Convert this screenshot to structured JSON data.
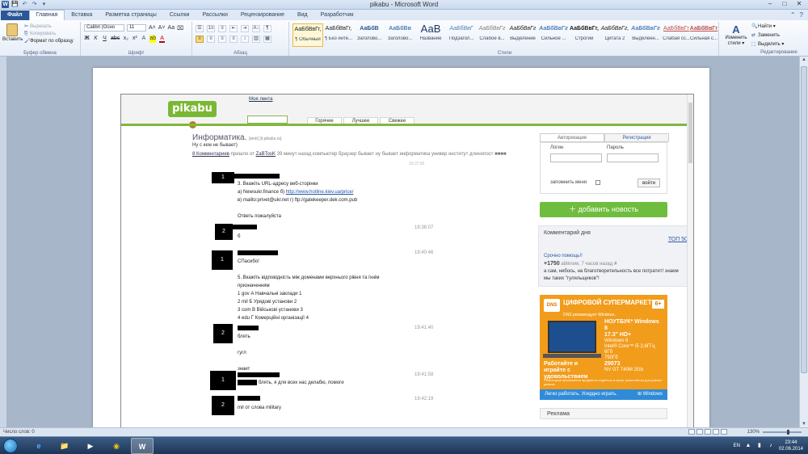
{
  "window": {
    "title": "pikabu - Microsoft Word",
    "controls": {
      "minimize": "–",
      "maximize": "□",
      "close": "✕"
    }
  },
  "qat": {
    "logo": "W",
    "save": "💾",
    "undo": "↶",
    "redo": "↷",
    "more": "▾"
  },
  "ribbon_tabs": [
    {
      "label": "Файл"
    },
    {
      "label": "Главная"
    },
    {
      "label": "Вставка"
    },
    {
      "label": "Разметка страницы"
    },
    {
      "label": "Ссылки"
    },
    {
      "label": "Рассылки"
    },
    {
      "label": "Рецензирование"
    },
    {
      "label": "Вид"
    },
    {
      "label": "Разработчик"
    }
  ],
  "clipboard": {
    "paste": "Вставить",
    "cut": "Вырезать",
    "copy": "Копировать",
    "format_painter": "Формат по образцу",
    "group_label": "Буфер обмена"
  },
  "font": {
    "family": "Calibri (Осно",
    "size": "11",
    "grow": "A˄",
    "shrink": "A˅",
    "change_case": "Aa",
    "clear": "⌧",
    "bold": "Ж",
    "italic": "К",
    "underline": "Ч",
    "strike": "abc",
    "subscript": "x₂",
    "superscript": "x²",
    "effects": "A",
    "highlight": "ab",
    "color": "A",
    "group_label": "Шрифт"
  },
  "paragraph": {
    "bullets": "☰",
    "numbering": "1≡",
    "multilevel": "≡",
    "decrease_indent": "⇤",
    "increase_indent": "⇥",
    "sort": "A↓",
    "pilcrow": "¶",
    "align_left": "≡",
    "align_center": "≡",
    "align_right": "≡",
    "justify": "≡",
    "line_spacing": "↕",
    "shading": "▥",
    "borders": "▦",
    "group_label": "Абзац"
  },
  "styles": {
    "group_label": "Стили",
    "items": [
      {
        "sample": "АаБбВвГг,",
        "name": "¶ Обычный"
      },
      {
        "sample": "АаБбВвГг,",
        "name": "¶ Без инте..."
      },
      {
        "sample": "АаБбВ",
        "name": "Заголово..."
      },
      {
        "sample": "АаБбВв",
        "name": "Заголово..."
      },
      {
        "sample": "АаВ",
        "name": "Название"
      },
      {
        "sample": "АаБбВвГ",
        "name": "Подзагол..."
      },
      {
        "sample": "АаБбВвГг",
        "name": "Слабое в..."
      },
      {
        "sample": "АаБбВвГг",
        "name": "Выделение"
      },
      {
        "sample": "АаБбВвГг",
        "name": "Сильное ..."
      },
      {
        "sample": "АаБбВвГг,",
        "name": "Строгий"
      },
      {
        "sample": "АаБбВвГг,",
        "name": "Цитата 2"
      },
      {
        "sample": "АаБбВвГг",
        "name": "Выделенн..."
      },
      {
        "sample": "АаБбВвГг",
        "name": "Слабая сс..."
      },
      {
        "sample": "АаБбВвГг",
        "name": "Сильная с..."
      }
    ]
  },
  "change_styles": {
    "icon": "A",
    "label": "Изменить стили ▾"
  },
  "editing": {
    "find": "Найти ▾",
    "replace": "Заменить",
    "select": "Выделить ▾",
    "group_label": "Редактирование"
  },
  "pikabu": {
    "logo_text": "pikabu",
    "my_tape": "Моя лента",
    "tabs": [
      "Горячее",
      "Лучшее",
      "Свежее"
    ],
    "post_title": "Информатика.",
    "post_title_tags": "[моё] [it.pikabu.ru]",
    "post_subtitle": "Ну с кем не бывает)",
    "post_meta_comments": "8 Комментариев",
    "post_meta_rest": " пришло от ",
    "post_meta_author": "ZaBTosK",
    "post_meta_tail": " 39 минут назад   компьютер  браузер  бывает  ну бывает  информатика  универ  институт  длинопост",
    "ghost_time": "19:37:56",
    "comments": [
      {
        "num": "1",
        "time": "",
        "lines": [
          "3. Вкажіть URL-адресу веб-сторінки",
          "а) Newsukr.finance б) ",
          "в) mailto:privet@ukr.net г) ftp://gatekeeper.dek.com.pub",
          "",
          "Ответь пожалуйста"
        ],
        "link_url": "http://www.hotline.kiev.ua/price/",
        "link_mail": "privet@ukr.net"
      },
      {
        "num": "2",
        "time": "19:38:07",
        "lines": [
          "б"
        ]
      },
      {
        "num": "1",
        "time": "19:40:46",
        "lines": [
          "СПасибо!",
          "",
          "5. Вкажіть відповідність між доменами верхнього рівня та їхнім",
          "призначенням",
          "1 gov А Навчальні заклади 1",
          "2 mil Б Урядові установи 2",
          "3 com В Військові установи 3",
          "4 edu Г Комерційні організації 4"
        ]
      },
      {
        "num": "2",
        "time": "19:41:40",
        "lines": [
          "блять",
          "",
          "гугл",
          "",
          "знает"
        ]
      },
      {
        "num": "1",
        "time": "19:41:58",
        "lines": [
          "блять, я для всех нас делабю, помоги"
        ]
      },
      {
        "num": "2",
        "time": "19:42:19",
        "lines": [
          "mil от слова military"
        ]
      }
    ],
    "sidebar": {
      "tab_login": "Авторизация",
      "tab_register": "Регистрация",
      "login_label": "Логин",
      "password_label": "Пароль",
      "remember": "запомнить меня",
      "login_button": "войти",
      "add_news": "＋ добавить новость",
      "cday_title": "Комментарий дня",
      "cday_top": "ТОП 50",
      "cday_link": "Срочно помощь!!",
      "cday_score": "+1750",
      "cday_user": "abiknow, 7 часов назад",
      "cday_hash": "#",
      "cday_text": "а сам, небось, на благотворительность все потратит! знаем мы таких \"гуляльщиков\"!",
      "reklama": "Реклама"
    },
    "ad": {
      "brand": "DNS",
      "headline": "ЦИФРОВОЙ СУПЕРМАРКЕТ",
      "sub": "DNS рекомендует Windows.",
      "age": "6+",
      "specs_title": "НОУТБУК* Windows 8",
      "specs_size": "17.3\" HD+",
      "specs_lines": [
        "Windows 8",
        "Intel® Core™ i5 2,6ГГц",
        "6Гб",
        "750Гб",
        "NV GT 740M 2Gb"
      ],
      "price": "29073",
      "slogan": "Работайте и играйте с удовольствием",
      "fine": "*Некоторые приложения продаются отдельно и могут различаться для разных рынков.",
      "bar": "Легко работать. Усердно играть.",
      "bar_win": "⊞ Windows"
    }
  },
  "statusbar": {
    "page": "Число слов: 0",
    "zoom": "130%"
  },
  "taskbar": {
    "apps": [
      "e",
      "📁",
      "▶",
      "◉",
      "W"
    ],
    "lang": "EN",
    "time": "23:44",
    "date": "02.06.2014"
  },
  "colors": {
    "word_blue": "#2b5797",
    "pikabu_green": "#80b93c",
    "add_news": "#6fbd3e",
    "ad_orange": "#f29c1c"
  }
}
